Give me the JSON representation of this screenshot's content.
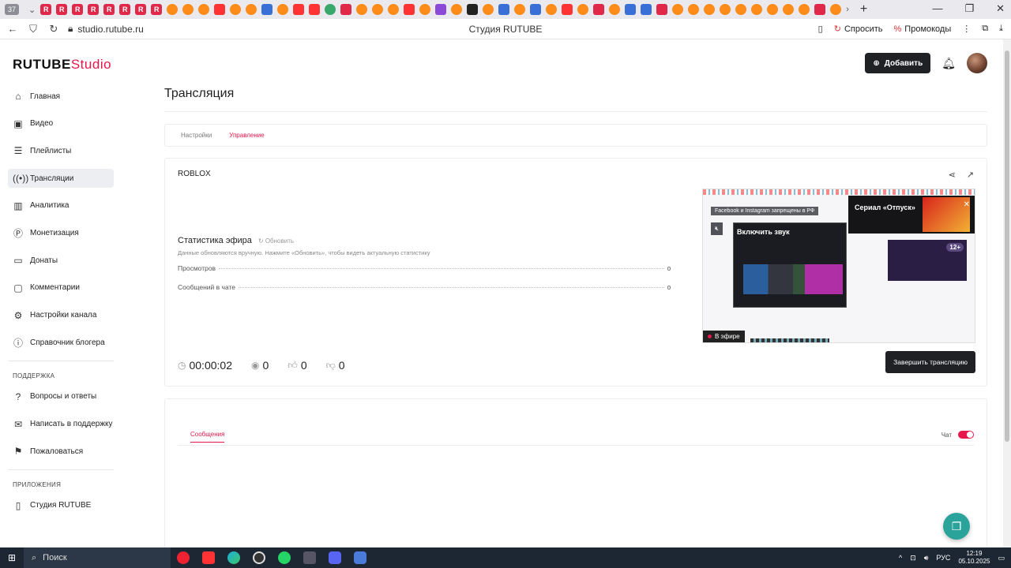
{
  "browser": {
    "tab_count": "37",
    "url": "studio.rutube.ru",
    "page_title": "Студия RUTUBE",
    "ask_label": "Спросить",
    "promo_label": "Промокоды"
  },
  "header": {
    "logo_main": "RUTUBE",
    "logo_accent": "Studio",
    "add_label": "Добавить"
  },
  "sidebar": {
    "items": [
      {
        "label": "Главная",
        "icon": "home-icon"
      },
      {
        "label": "Видео",
        "icon": "video-icon"
      },
      {
        "label": "Плейлисты",
        "icon": "playlist-icon"
      },
      {
        "label": "Трансляции",
        "icon": "broadcast-icon",
        "active": true
      },
      {
        "label": "Аналитика",
        "icon": "analytics-icon"
      },
      {
        "label": "Монетизация",
        "icon": "monetization-icon"
      },
      {
        "label": "Донаты",
        "icon": "donate-icon"
      },
      {
        "label": "Комментарии",
        "icon": "comments-icon"
      },
      {
        "label": "Настройки канала",
        "icon": "gear-icon"
      },
      {
        "label": "Справочник блогера",
        "icon": "info-icon"
      }
    ],
    "support_heading": "ПОДДЕРЖКА",
    "support_items": [
      {
        "label": "Вопросы и ответы",
        "icon": "question-icon"
      },
      {
        "label": "Написать в поддержку",
        "icon": "mail-icon"
      },
      {
        "label": "Пожаловаться",
        "icon": "flag-icon"
      }
    ],
    "apps_heading": "ПРИЛОЖЕНИЯ",
    "apps_items": [
      {
        "label": "Студия RUTUBE",
        "icon": "app-icon"
      }
    ]
  },
  "page": {
    "title": "Трансляция",
    "tabs": [
      {
        "label": "Настройки",
        "active": false
      },
      {
        "label": "Управление",
        "active": true
      }
    ]
  },
  "stream": {
    "name": "ROBLOX",
    "stats_title": "Статистика эфира",
    "refresh_label": "Обновить",
    "stats_note": "Данные обновляются вручную. Нажмите «Обновить», чтобы видеть актуальную статистику",
    "stats": [
      {
        "label": "Просмотров",
        "value": "0"
      },
      {
        "label": "Сообщений в чате",
        "value": "0"
      }
    ],
    "duration": "00:00:02",
    "viewers": "0",
    "likes": "0",
    "dislikes": "0",
    "end_label": "Завершить трансляцию"
  },
  "preview": {
    "banner_text": "Facebook и Instagram запрещены в РФ",
    "sound_text": "Включить звук",
    "ad_text": "Сериал «Отпуск»",
    "age": "12+",
    "live_label": "В эфире"
  },
  "chat": {
    "tab_label": "Сообщения",
    "toggle_label": "Чат",
    "enabled": true
  },
  "taskbar": {
    "search_label": "Поиск",
    "lang": "РУС",
    "time": "12:19",
    "date": "05.10.2025"
  },
  "colors": {
    "accent": "#e8174b",
    "dark_button": "#1f2125"
  }
}
